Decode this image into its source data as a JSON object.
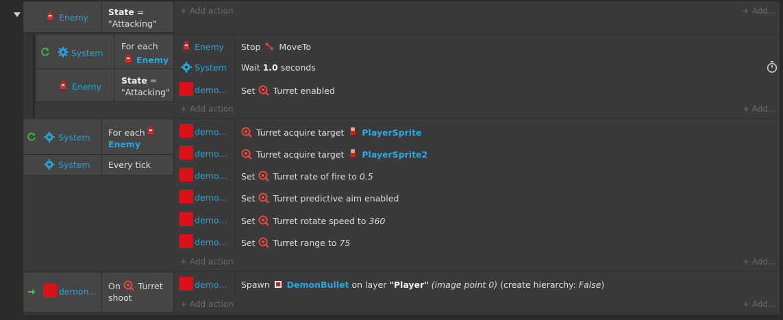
{
  "add_action": "+ Add action",
  "add_right": "+ Add...",
  "event1": {
    "cond_object": "Enemy",
    "cond_text_strong": "State",
    "cond_text_eq": " =",
    "cond_text_value": "\"Attacking\""
  },
  "subevent": {
    "cond1_object": "System",
    "cond1_text": "For each",
    "cond1_target": "Enemy",
    "cond2_object": "Enemy",
    "cond2_text_strong": "State",
    "cond2_text_eq": " =",
    "cond2_text_value": "\"Attacking\"",
    "actions": [
      {
        "object": "Enemy",
        "verb": "Stop",
        "behavior": "MoveTo"
      },
      {
        "object": "System",
        "verb": "Wait",
        "value": "1.0",
        "suffix": "seconds"
      },
      {
        "object": "demo...",
        "verb": "Set",
        "behavior": "Turret",
        "suffix": "enabled"
      }
    ]
  },
  "event2": {
    "cond1_object": "System",
    "cond1_text": "For each",
    "cond1_target": "Enemy",
    "cond2_object": "System",
    "cond2_text": "Every tick",
    "actions": [
      {
        "object": "demo...",
        "behavior": "Turret",
        "text": "acquire target",
        "target": "PlayerSprite"
      },
      {
        "object": "demo...",
        "behavior": "Turret",
        "text": "acquire target",
        "target": "PlayerSprite2"
      },
      {
        "object": "demo...",
        "verb": "Set",
        "behavior": "Turret",
        "text": "rate of fire to",
        "value": "0.5"
      },
      {
        "object": "demo...",
        "verb": "Set",
        "behavior": "Turret",
        "text": "predictive aim enabled"
      },
      {
        "object": "demo...",
        "verb": "Set",
        "behavior": "Turret",
        "text": "rotate speed to",
        "value": "360"
      },
      {
        "object": "demo...",
        "verb": "Set",
        "behavior": "Turret",
        "text": "range to",
        "value": "75"
      }
    ]
  },
  "event3": {
    "cond_object": "demon...",
    "cond_text_on": "On",
    "cond_behavior": "Turret",
    "cond_text_shoot": "shoot",
    "action": {
      "object": "demo...",
      "verb": "Spawn",
      "target": "DemonBullet",
      "text_on_layer": "on layer",
      "layer": "\"Player\"",
      "image_point": "(image point 0)",
      "hierarchy_prefix": "(create hierarchy:",
      "hierarchy_value": "False",
      "hierarchy_suffix": ")"
    }
  },
  "colors": {
    "object_blue": "#2aa1d3",
    "turret_red": "#e8473f",
    "system_gear": "#2aa1d3",
    "loop_green": "#3fbf3f",
    "sprite_red": "#d9111a"
  }
}
